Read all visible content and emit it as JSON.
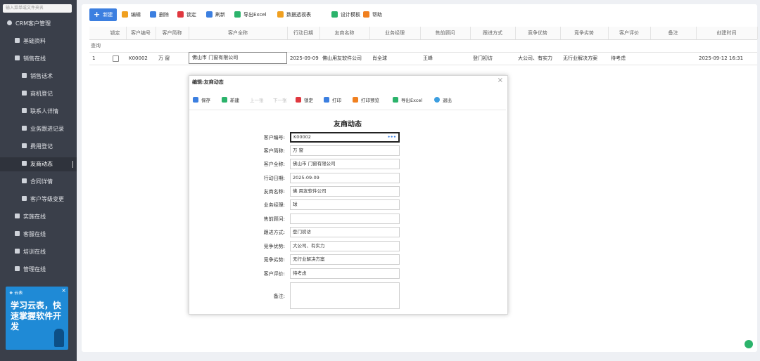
{
  "sidebar": {
    "search_placeholder": "输入菜单或文件夹名",
    "items": [
      {
        "label": "CRM客户管理",
        "level": "l0",
        "icon": "user-icon"
      },
      {
        "label": "基础资料",
        "level": "l1",
        "icon": "folder-icon"
      },
      {
        "label": "销售在线",
        "level": "l1",
        "icon": "folder-icon"
      },
      {
        "label": "销售话术",
        "level": "l2",
        "icon": "document-icon"
      },
      {
        "label": "商机登记",
        "level": "l2",
        "icon": "document-icon"
      },
      {
        "label": "联系人详情",
        "level": "l2",
        "icon": "document-icon"
      },
      {
        "label": "业务跟进记录",
        "level": "l2",
        "icon": "document-icon"
      },
      {
        "label": "费用登记",
        "level": "l2",
        "icon": "document-icon"
      },
      {
        "label": "友商动态",
        "level": "l2",
        "icon": "document-icon",
        "active": true
      },
      {
        "label": "合同详情",
        "level": "l2",
        "icon": "document-icon"
      },
      {
        "label": "客户等级变更",
        "level": "l2",
        "icon": "document-icon"
      },
      {
        "label": "实施在线",
        "level": "l1",
        "icon": "folder-icon"
      },
      {
        "label": "客服在线",
        "level": "l1",
        "icon": "folder-icon"
      },
      {
        "label": "培训在线",
        "level": "l1",
        "icon": "folder-icon"
      },
      {
        "label": "管理在线",
        "level": "l1",
        "icon": "folder-icon"
      }
    ],
    "ad": {
      "text": "学习云表，快速掌握软件开发",
      "close": "×"
    }
  },
  "toolbar": [
    {
      "label": "新建",
      "icon": "plus-icon",
      "color": "#3c7fe0"
    },
    {
      "label": "编辑",
      "icon": "edit-icon",
      "color": "#f0a020"
    },
    {
      "label": "删除",
      "icon": "delete-icon",
      "color": "#3c7fe0"
    },
    {
      "label": "锁定",
      "icon": "lock-icon",
      "color": "#e0383f"
    },
    {
      "label": "刷新",
      "icon": "refresh-icon",
      "color": "#3c7fe0"
    },
    {
      "label": "导出Excel",
      "icon": "excel-icon",
      "color": "#2bb36b"
    },
    {
      "label": "数据透视表",
      "icon": "pivot-icon",
      "color": "#f0a020"
    },
    {
      "label": "设计模板",
      "icon": "template-icon",
      "color": "#2bb36b"
    },
    {
      "label": "帮助",
      "icon": "help-icon",
      "color": "#f08020"
    }
  ],
  "grid": {
    "columns": [
      "锁定",
      "客户编号",
      "客户简称",
      "客户全称",
      "行动日期",
      "友商名称",
      "业务经理",
      "售前顾问",
      "跟进方式",
      "竞争优势",
      "竞争劣势",
      "客户评价",
      "备注",
      "创建时间"
    ],
    "filter_label": "查询",
    "rows": [
      {
        "index": "1",
        "客户编号": "K00002",
        "客户简称": "万 窗",
        "客户全称": "佛山市 门窗有限公司",
        "行动日期": "2025-09-09",
        "友商名称": "佛山用友软件公司",
        "业务经理": "肖全球",
        "售前顾问": "王峰",
        "跟进方式": "登门初访",
        "竞争优势": "大公司、有实力",
        "竞争劣势": "无行业解决方案",
        "客户评价": "待考虑",
        "备注": "",
        "创建时间": "2025-09-12 16:31"
      }
    ]
  },
  "dialog": {
    "title": "编辑:友商动态",
    "close": "×",
    "toolbar": [
      {
        "label": "保存",
        "icon": "save-icon",
        "color": "#3c7fe0",
        "disabled": false
      },
      {
        "label": "新建",
        "icon": "plus-icon",
        "color": "#2bb36b",
        "disabled": false
      },
      {
        "label": "上一张",
        "icon": "",
        "color": "",
        "disabled": true
      },
      {
        "label": "下一张",
        "icon": "",
        "color": "",
        "disabled": true
      },
      {
        "label": "锁定",
        "icon": "lock-icon",
        "color": "#e0383f",
        "disabled": false
      },
      {
        "label": "打印",
        "icon": "print-icon",
        "color": "#3c7fe0",
        "disabled": false
      },
      {
        "label": "打印预览",
        "icon": "preview-icon",
        "color": "#f08020",
        "disabled": false
      },
      {
        "label": "导出Excel",
        "icon": "excel-icon",
        "color": "#2bb36b",
        "disabled": false
      },
      {
        "label": "退出",
        "icon": "power-icon",
        "color": "#3c9ee0",
        "disabled": false
      }
    ],
    "form_title": "友商动态",
    "fields": [
      {
        "label": "客户编号:",
        "value": "K00002",
        "focus": true
      },
      {
        "label": "客户简称:",
        "value": "万 窗"
      },
      {
        "label": "客户全称:",
        "value": "佛山市 门窗有限公司"
      },
      {
        "label": "行动日期:",
        "value": "2025-09-09"
      },
      {
        "label": "友商名称:",
        "value": "佛 用友软件公司"
      },
      {
        "label": "业务经理:",
        "value": "球"
      },
      {
        "label": "售前顾问:",
        "value": ""
      },
      {
        "label": "跟进方式:",
        "value": "登门初访"
      },
      {
        "label": "竞争优势:",
        "value": "大公司、有实力"
      },
      {
        "label": "竞争劣势:",
        "value": "无行业解决方案"
      },
      {
        "label": "客户评价:",
        "value": "待考虑"
      },
      {
        "label": "备注:",
        "value": "",
        "area": true
      }
    ],
    "lookup_glyph": "•••"
  }
}
